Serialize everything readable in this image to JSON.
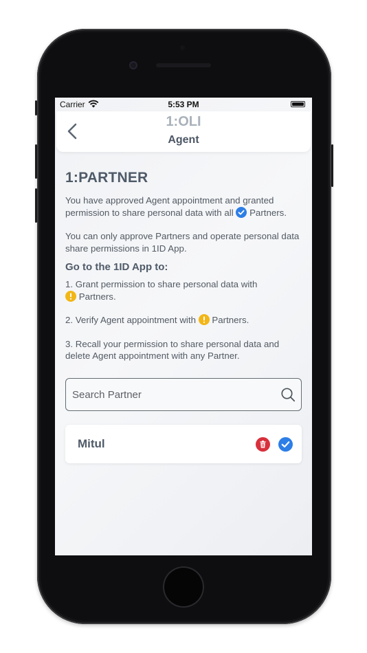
{
  "status_bar": {
    "carrier": "Carrier",
    "time": "5:53 PM"
  },
  "header": {
    "app_title": "1:OLI",
    "subtitle": "Agent"
  },
  "page": {
    "heading": "1:PARTNER",
    "approved_text_before": "You have approved Agent appointment and granted permission to share personal data with all",
    "approved_text_after": "Partners.",
    "only_approve_text": "You can only approve Partners and operate personal data share permissions in 1ID App.",
    "go_to_heading": "Go to the 1ID App to:",
    "steps": {
      "step1_before": "1. Grant permission to share personal data with",
      "step1_after": "Partners.",
      "step2_before": "2. Verify Agent appointment with",
      "step2_after": "Partners.",
      "step3": "3. Recall your permission to share personal data and delete Agent appointment with any Partner."
    }
  },
  "search": {
    "placeholder": "Search Partner",
    "value": "",
    "icon": "search-icon"
  },
  "partners": [
    {
      "name": "Mitul",
      "actions": [
        "trash-icon",
        "check-circle-icon"
      ]
    }
  ],
  "colors": {
    "verified_blue": "#2d7ee6",
    "warning_yellow": "#f2b617",
    "delete_red": "#d8303c",
    "text_dark": "#4f5a68"
  }
}
